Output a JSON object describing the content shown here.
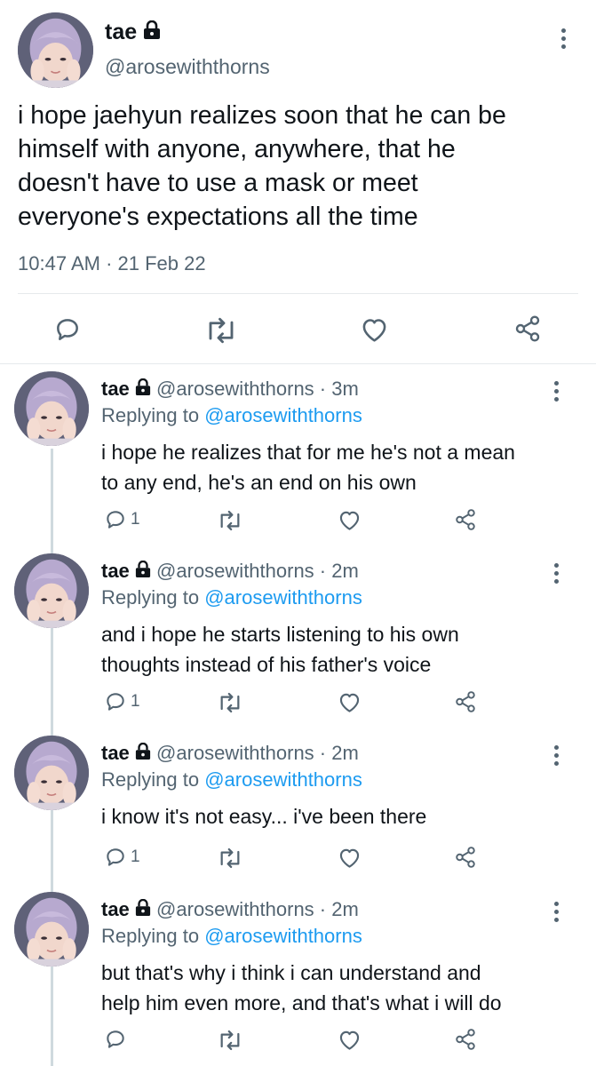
{
  "main_tweet": {
    "display_name": "tae",
    "handle": "@arosewiththorns",
    "text_lines": [
      "i hope jaehyun realizes soon that he can be",
      "himself with anyone, anywhere, that he",
      "doesn't have to use a mask or meet",
      "everyone's expectations all the time"
    ],
    "time": "10:47 AM",
    "separator": "·",
    "date": "21 Feb 22"
  },
  "replies": [
    {
      "display_name": "tae",
      "meta": "@arosewiththorns · 3m",
      "replying_prefix": "Replying to",
      "replying_handle": "@arosewiththorns",
      "text_lines": [
        "i hope he realizes that for me he's not a mean",
        "to any end, he's an end on his own"
      ],
      "reply_count": "1"
    },
    {
      "display_name": "tae",
      "meta": "@arosewiththorns · 2m",
      "replying_prefix": "Replying to",
      "replying_handle": "@arosewiththorns",
      "text_lines": [
        "and i hope he starts listening to his own",
        "thoughts instead of his father's voice"
      ],
      "reply_count": "1"
    },
    {
      "display_name": "tae",
      "meta": "@arosewiththorns · 2m",
      "replying_prefix": "Replying to",
      "replying_handle": "@arosewiththorns",
      "text_lines": [
        "i know it's not easy... i've been there"
      ],
      "reply_count": "1"
    },
    {
      "display_name": "tae",
      "meta": "@arosewiththorns · 2m",
      "replying_prefix": "Replying to",
      "replying_handle": "@arosewiththorns",
      "text_lines": [
        "but that's why i think i can understand and",
        "help him even more, and that's what i will do"
      ],
      "reply_count": ""
    }
  ],
  "icons": {
    "lock": "lock-icon",
    "more": "more-options-icon",
    "reply": "reply-icon",
    "retweet": "retweet-icon",
    "like": "like-icon",
    "share": "share-icon"
  },
  "colors": {
    "text": "#0f1419",
    "muted": "#536471",
    "link": "#1d9bf0",
    "divider": "#e6e9ec"
  }
}
